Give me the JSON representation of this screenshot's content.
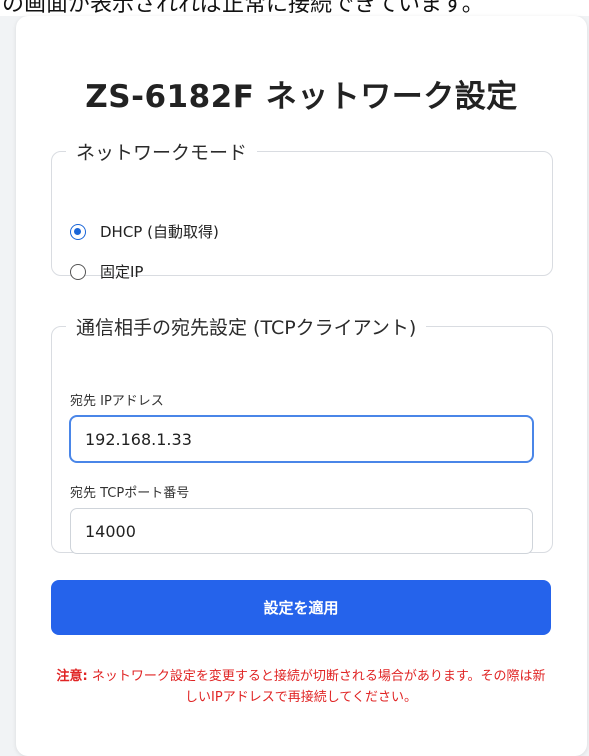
{
  "top_fragment": "の画面が表示されれば正常に接続できています。",
  "page_title": "ZS-6182F ネットワーク設定",
  "network_mode": {
    "legend": "ネットワークモード",
    "options": [
      {
        "label": "DHCP (自動取得)",
        "checked": true
      },
      {
        "label": "固定IP",
        "checked": false
      }
    ]
  },
  "destination": {
    "legend": "通信相手の宛先設定 (TCPクライアント)",
    "ip_label": "宛先 IPアドレス",
    "ip_value": "192.168.1.33",
    "port_label": "宛先 TCPポート番号",
    "port_value": "14000"
  },
  "apply_button": "設定を適用",
  "note": {
    "prefix": "注意:",
    "text": "ネットワーク設定を変更すると接続が切断される場合があります。その際は新しいIPアドレスで再接続してください。"
  },
  "colors": {
    "accent": "#2563eb",
    "warning": "#e02424"
  }
}
